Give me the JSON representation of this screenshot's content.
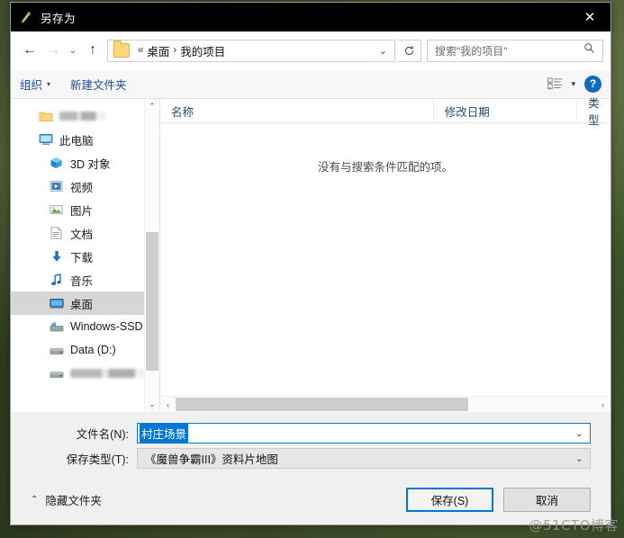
{
  "window": {
    "title": "另存为",
    "icon": "warcraft-editor-icon",
    "close_label": "✕"
  },
  "nav": {
    "back": "←",
    "forward": "→",
    "history": "⌄",
    "up": "↑",
    "breadcrumb": {
      "prefix": "«",
      "items": [
        "桌面",
        "我的项目"
      ],
      "separator": "›"
    },
    "dropdown": "⌄",
    "refresh_label": "刷新",
    "search": {
      "placeholder": "搜索\"我的项目\"",
      "icon": "search-icon"
    }
  },
  "toolbar": {
    "organize": "组织",
    "organize_caret": "▾",
    "new_folder": "新建文件夹",
    "view_caret": "▾",
    "help": "?"
  },
  "sidebar": {
    "items": [
      {
        "label": "",
        "icon": "folder-icon",
        "redacted": true,
        "indent": false,
        "selected": false
      },
      {
        "label": "此电脑",
        "icon": "this-pc-icon",
        "indent": false,
        "selected": false
      },
      {
        "label": "3D 对象",
        "icon": "3d-objects-icon",
        "indent": true,
        "selected": false
      },
      {
        "label": "视频",
        "icon": "videos-icon",
        "indent": true,
        "selected": false
      },
      {
        "label": "图片",
        "icon": "pictures-icon",
        "indent": true,
        "selected": false
      },
      {
        "label": "文档",
        "icon": "documents-icon",
        "indent": true,
        "selected": false
      },
      {
        "label": "下载",
        "icon": "downloads-icon",
        "indent": true,
        "selected": false
      },
      {
        "label": "音乐",
        "icon": "music-icon",
        "indent": true,
        "selected": false
      },
      {
        "label": "桌面",
        "icon": "desktop-icon",
        "indent": true,
        "selected": true
      },
      {
        "label": "Windows-SSD",
        "icon": "drive-icon",
        "indent": true,
        "selected": false
      },
      {
        "label": "Data (D:)",
        "icon": "drive-icon",
        "indent": true,
        "selected": false
      },
      {
        "label": "",
        "icon": "drive-icon",
        "redacted": true,
        "indent": true,
        "selected": false
      }
    ],
    "scroll_up": "⌃",
    "scroll_down": "⌄"
  },
  "filelist": {
    "columns": [
      "名称",
      "修改日期",
      "类型"
    ],
    "empty_message": "没有与搜索条件匹配的项。",
    "scroll_left": "‹",
    "scroll_right": "›"
  },
  "form": {
    "filename_label": "文件名(N):",
    "filename_value": "村庄场景",
    "filename_caret": "⌄",
    "filetype_label": "保存类型(T):",
    "filetype_value": "《魔兽争霸III》资料片地图",
    "filetype_caret": "⌄"
  },
  "footer": {
    "hide_folders": "隐藏文件夹",
    "hide_folders_caret": "⌃",
    "save": "保存(S)",
    "cancel": "取消"
  },
  "watermark": "@51CTO博客",
  "colors": {
    "accent": "#0078d7",
    "titlebar": "#000000",
    "dialog_bg": "#f0f0f0",
    "link": "#1d4c8f",
    "selection": "#0078d7"
  }
}
